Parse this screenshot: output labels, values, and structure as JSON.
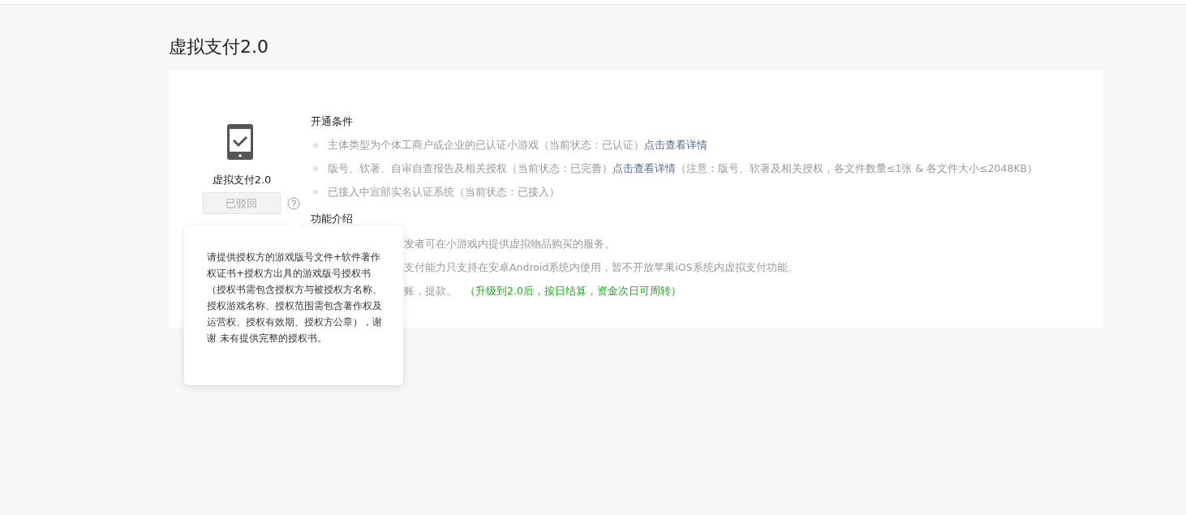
{
  "page": {
    "title": "虚拟支付2.0"
  },
  "product": {
    "name": "虚拟支付2.0",
    "button": {
      "label": "已驳回",
      "disabled": true
    }
  },
  "conditions": {
    "heading": "开通条件",
    "items": [
      {
        "text": "主体类型为个体工商户或企业的已认证小游戏（当前状态：已认证）",
        "link": "点击查看详情"
      },
      {
        "text": "版号、软著、自审自查报告及相关授权（当前状态：已完善）",
        "link": "点击查看详情",
        "note": "（注意：版号、软著及相关授权，各文件数量≤1张 & 各文件大小≤2048KB）"
      },
      {
        "text": "已接入中宣部实名认证系统（当前状态：已接入）"
      }
    ]
  },
  "features": {
    "heading": "功能介绍",
    "items": [
      {
        "text": "发者可在小游戏内提供虚拟物品购买的服务。"
      },
      {
        "text": "支付能力只支持在安卓Android系统内使用，暂不开放苹果iOS系统内虚拟支付功能。"
      },
      {
        "text": "账，提款。",
        "highlight": "（升级到2.0后，按日结算，资金次日可周转）"
      }
    ]
  },
  "tooltip": {
    "text": "请提供授权方的游戏版号文件+软件著作权证书+授权方出具的游戏版号授权书（授权书需包含授权方与被授权方名称、授权游戏名称、授权范围需包含著作权及运营权、授权有效期、授权方公章），谢谢 未有提供完整的授权书。"
  }
}
